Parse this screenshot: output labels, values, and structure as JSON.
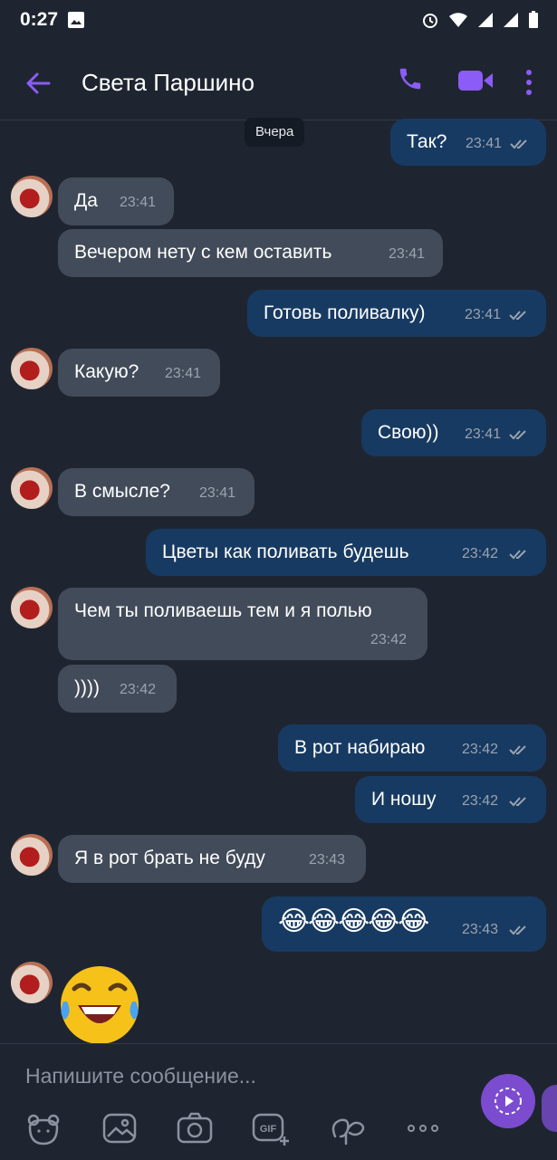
{
  "status": {
    "time": "0:27"
  },
  "header": {
    "title": "Света Паршино"
  },
  "date_separator": "Вчера",
  "messages": [
    {
      "dir": "out",
      "text": "Так?",
      "time": "23:41"
    },
    {
      "dir": "in",
      "text": "Да",
      "time": "23:41"
    },
    {
      "dir": "in",
      "text": "Вечером нету с кем оставить",
      "time": "23:41"
    },
    {
      "dir": "out",
      "text": "Готовь поливалку)",
      "time": "23:41"
    },
    {
      "dir": "in",
      "text": "Какую?",
      "time": "23:41"
    },
    {
      "dir": "out",
      "text": "Свою))",
      "time": "23:41"
    },
    {
      "dir": "in",
      "text": "В смысле?",
      "time": "23:41"
    },
    {
      "dir": "out",
      "text": "Цветы как поливать будешь",
      "time": "23:42"
    },
    {
      "dir": "in",
      "text": "Чем ты поливаешь тем и я полью",
      "time": "23:42"
    },
    {
      "dir": "in",
      "text": "))))",
      "time": "23:42"
    },
    {
      "dir": "out",
      "text": "В рот набираю",
      "time": "23:42"
    },
    {
      "dir": "out",
      "text": "И ношу",
      "time": "23:42"
    },
    {
      "dir": "in",
      "text": "Я в рот брать не буду",
      "time": "23:43"
    },
    {
      "dir": "out",
      "text": "😂😂😂😂😂",
      "time": "23:43"
    }
  ],
  "composer": {
    "placeholder": "Напишите сообщение..."
  },
  "icons": [
    "back-arrow-icon",
    "phone-icon",
    "video-call-icon",
    "more-vert-icon",
    "sticker-bear-icon",
    "gallery-icon",
    "camera-icon",
    "gif-icon",
    "doodle-icon",
    "more-dots-icon",
    "send-icon"
  ],
  "colors": {
    "bg": "#1f2530",
    "incoming": "#424b59",
    "outgoing": "#173a62",
    "accent": "#7b4ccf"
  }
}
